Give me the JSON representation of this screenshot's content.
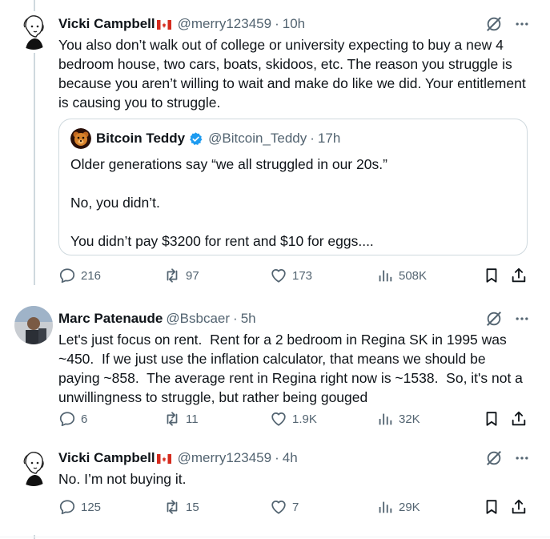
{
  "tweets": [
    {
      "name": "Vicki Campbell",
      "handle": "@merry123459",
      "dot": "·",
      "time": "10h",
      "text": "You also don’t walk out of college or university expecting to buy a new 4 bedroom house, two cars, boats, skidoos, etc. The reason you struggle is because you aren’t willing to wait and make do like we did. Your entitlement is causing you to struggle.",
      "quote": {
        "name": "Bitcoin Teddy",
        "handle": "@Bitcoin_Teddy",
        "dot": "·",
        "time": "17h",
        "text": "Older generations say “we all struggled in our 20s.”\n\nNo, you didn’t.\n\nYou didn’t pay $3200 for rent and $10 for eggs...."
      },
      "replies": "216",
      "reposts": "97",
      "likes": "173",
      "views": "508K"
    },
    {
      "name": "Marc Patenaude",
      "handle": "@Bsbcaer",
      "dot": "·",
      "time": "5h",
      "text": "Let's just focus on rent.  Rent for a 2 bedroom in Regina SK in 1995 was ~450.  If we just use the inflation calculator, that means we should be paying ~858.  The average rent in Regina right now is ~1538.  So, it's not a unwillingness to struggle, but rather being gouged",
      "replies": "6",
      "reposts": "11",
      "likes": "1.9K",
      "views": "32K"
    },
    {
      "name": "Vicki Campbell",
      "handle": "@merry123459",
      "dot": "·",
      "time": "4h",
      "text": "No. I’m not buying it.",
      "replies": "125",
      "reposts": "15",
      "likes": "7",
      "views": "29K"
    }
  ],
  "colors": {
    "text": "#0f1419",
    "secondary": "#536471",
    "border": "#cfd9de",
    "verified": "#1d9bf0",
    "flag_red": "#d52b1e"
  },
  "icons": [
    "canada-flag-icon",
    "grok-icon",
    "more-icon",
    "verified-icon",
    "reply-icon",
    "repost-icon",
    "like-icon",
    "views-icon",
    "bookmark-icon",
    "share-icon"
  ]
}
